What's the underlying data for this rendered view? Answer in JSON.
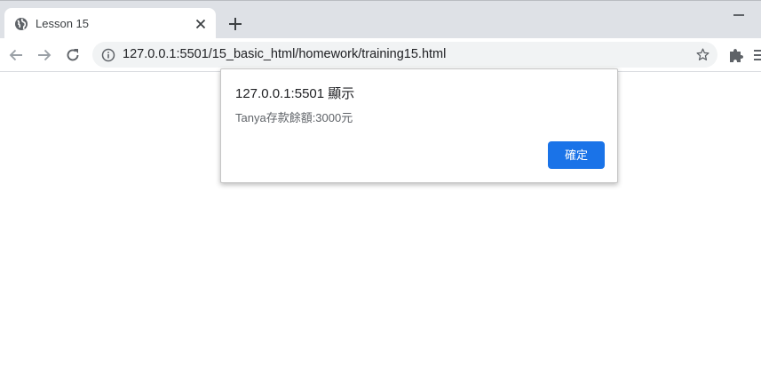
{
  "tab": {
    "title": "Lesson 15",
    "favicon": "globe-icon"
  },
  "toolbar": {
    "url": "127.0.0.1:5501/15_basic_html/homework/training15.html"
  },
  "dialog": {
    "title": "127.0.0.1:5501 顯示",
    "message": "Tanya存款餘額:3000元",
    "ok_label": "確定"
  },
  "colors": {
    "accent": "#1a73e8",
    "tabstrip": "#dee1e6",
    "omnibox": "#f1f3f4"
  }
}
